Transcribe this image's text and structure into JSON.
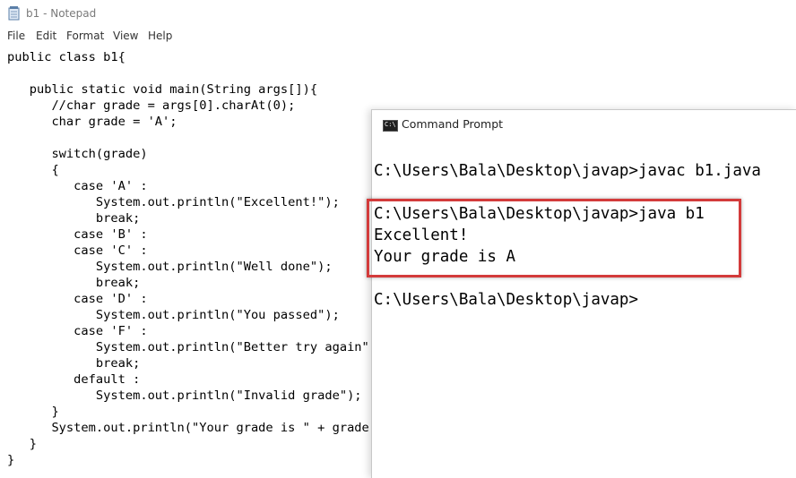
{
  "notepad": {
    "title": "b1 - Notepad",
    "menu": [
      "File",
      "Edit",
      "Format",
      "View",
      "Help"
    ],
    "code_lines": [
      "public class b1{",
      "",
      "   public static void main(String args[]){",
      "      //char grade = args[0].charAt(0);",
      "      char grade = 'A';",
      "",
      "      switch(grade)",
      "      {",
      "         case 'A' :",
      "            System.out.println(\"Excellent!\");",
      "            break;",
      "         case 'B' :",
      "         case 'C' :",
      "            System.out.println(\"Well done\");",
      "            break;",
      "         case 'D' :",
      "            System.out.println(\"You passed\");",
      "         case 'F' :",
      "            System.out.println(\"Better try again\");",
      "            break;",
      "         default :",
      "            System.out.println(\"Invalid grade\");",
      "      }",
      "      System.out.println(\"Your grade is \" + grade);",
      "   }",
      "}"
    ]
  },
  "cmd": {
    "title": "Command Prompt",
    "icon_text": "C:\\",
    "lines": [
      "C:\\Users\\Bala\\Desktop\\javap>javac b1.java",
      "C:\\Users\\Bala\\Desktop\\javap>java b1",
      "Excellent!",
      "Your grade is A",
      "C:\\Users\\Bala\\Desktop\\javap>"
    ]
  },
  "colors": {
    "highlight_border": "#d33b3b"
  }
}
